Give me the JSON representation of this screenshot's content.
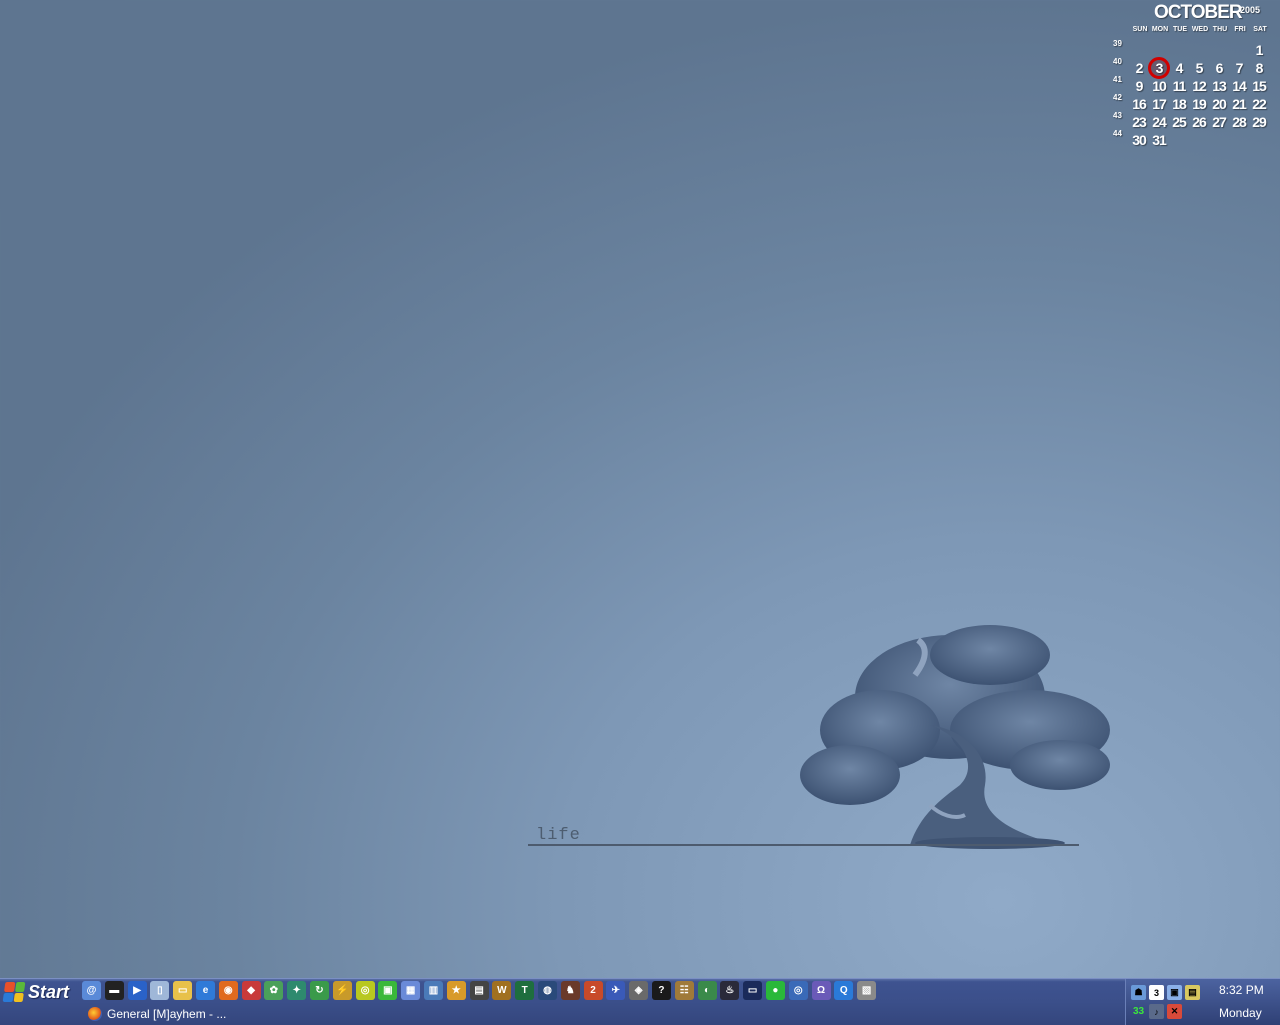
{
  "calendar": {
    "month": "OCTOBER",
    "year": "2005",
    "days_of_week": [
      "SUN",
      "MON",
      "TUE",
      "WED",
      "THU",
      "FRI",
      "SAT"
    ],
    "today": "3",
    "weeks": [
      {
        "number": "39",
        "days": [
          "",
          "",
          "",
          "",
          "",
          "",
          "1"
        ]
      },
      {
        "number": "40",
        "days": [
          "2",
          "3",
          "4",
          "5",
          "6",
          "7",
          "8"
        ]
      },
      {
        "number": "41",
        "days": [
          "9",
          "10",
          "11",
          "12",
          "13",
          "14",
          "15"
        ]
      },
      {
        "number": "42",
        "days": [
          "16",
          "17",
          "18",
          "19",
          "20",
          "21",
          "22"
        ]
      },
      {
        "number": "43",
        "days": [
          "23",
          "24",
          "25",
          "26",
          "27",
          "28",
          "29"
        ]
      },
      {
        "number": "44",
        "days": [
          "30",
          "31",
          "",
          "",
          "",
          "",
          ""
        ]
      }
    ],
    "today_ring_color": "#d00000"
  },
  "wallpaper": {
    "caption": "life",
    "tree_icon": "bonsai-tree-icon"
  },
  "taskbar": {
    "start_label": "Start",
    "quick_launch": [
      {
        "name": "quick-launch-messenger-icon",
        "color": "#5a8ad8",
        "glyph": "@"
      },
      {
        "name": "quick-launch-meter-icon",
        "color": "#222222",
        "glyph": "▬"
      },
      {
        "name": "quick-launch-media-player-icon",
        "color": "#2a62c8",
        "glyph": "▶"
      },
      {
        "name": "quick-launch-recycle-bin-icon",
        "color": "#9fb7d8",
        "glyph": "▯"
      },
      {
        "name": "quick-launch-folder-icon",
        "color": "#e8c14a",
        "glyph": "▭"
      },
      {
        "name": "quick-launch-internet-explorer-icon",
        "color": "#2f7ad8",
        "glyph": "e"
      },
      {
        "name": "quick-launch-firefox-icon",
        "color": "#e06a1e",
        "glyph": "◉"
      },
      {
        "name": "quick-launch-shield-icon",
        "color": "#c83a3a",
        "glyph": "◆"
      },
      {
        "name": "quick-launch-msn-icon",
        "color": "#4aa05a",
        "glyph": "✿"
      },
      {
        "name": "quick-launch-network-icon",
        "color": "#2e8a6e",
        "glyph": "✦"
      },
      {
        "name": "quick-launch-refresh-icon",
        "color": "#3a9a4a",
        "glyph": "↻"
      },
      {
        "name": "quick-launch-winamp-icon",
        "color": "#c89a2a",
        "glyph": "⚡"
      },
      {
        "name": "quick-launch-yellow-app-icon",
        "color": "#b8c820",
        "glyph": "◎"
      },
      {
        "name": "quick-launch-green-app-icon",
        "color": "#3ab83a",
        "glyph": "▣"
      },
      {
        "name": "quick-launch-image-icon",
        "color": "#6a8ad8",
        "glyph": "▦"
      },
      {
        "name": "quick-launch-photo-icon",
        "color": "#4a7ab8",
        "glyph": "▥"
      },
      {
        "name": "quick-launch-runner-icon",
        "color": "#d89a2a",
        "glyph": "★"
      },
      {
        "name": "quick-launch-window-icon",
        "color": "#444444",
        "glyph": "▤"
      },
      {
        "name": "quick-launch-warcraft-icon",
        "color": "#a07020",
        "glyph": "W"
      },
      {
        "name": "quick-launch-green-circle-icon",
        "color": "#1e6e3e",
        "glyph": "T"
      },
      {
        "name": "quick-launch-globe-icon",
        "color": "#2a4a7a",
        "glyph": "◍"
      },
      {
        "name": "quick-launch-game-icon",
        "color": "#6a3a2a",
        "glyph": "♞"
      },
      {
        "name": "quick-launch-two-icon",
        "color": "#c84a2a",
        "glyph": "2"
      },
      {
        "name": "quick-launch-compass-icon",
        "color": "#3a5ab8",
        "glyph": "✈"
      },
      {
        "name": "quick-launch-cube-icon",
        "color": "#6a6a6a",
        "glyph": "◈"
      },
      {
        "name": "quick-launch-help-icon",
        "color": "#1a1a1a",
        "glyph": "?"
      },
      {
        "name": "quick-launch-crowd-icon",
        "color": "#a07a3a",
        "glyph": "☷"
      },
      {
        "name": "quick-launch-earth-icon",
        "color": "#3a8a4a",
        "glyph": "◐"
      },
      {
        "name": "quick-launch-steam-icon",
        "color": "#2a2a3a",
        "glyph": "♨"
      },
      {
        "name": "quick-launch-console-icon",
        "color": "#1a2a5a",
        "glyph": "▭"
      },
      {
        "name": "quick-launch-green-orb-icon",
        "color": "#2ab83a",
        "glyph": "●"
      },
      {
        "name": "quick-launch-network-globe-icon",
        "color": "#3a6ab8",
        "glyph": "◎"
      },
      {
        "name": "quick-launch-headphones-icon",
        "color": "#6a5ab8",
        "glyph": "Ω"
      },
      {
        "name": "quick-launch-search-icon",
        "color": "#2a7ad8",
        "glyph": "Q"
      },
      {
        "name": "quick-launch-clapper-icon",
        "color": "#8a8a8a",
        "glyph": "▧"
      }
    ],
    "window_title": "General [M]ayhem - ...",
    "tray": {
      "time": "8:32 PM",
      "day": "Monday",
      "desktop_number": "3",
      "green_label": "33"
    }
  }
}
